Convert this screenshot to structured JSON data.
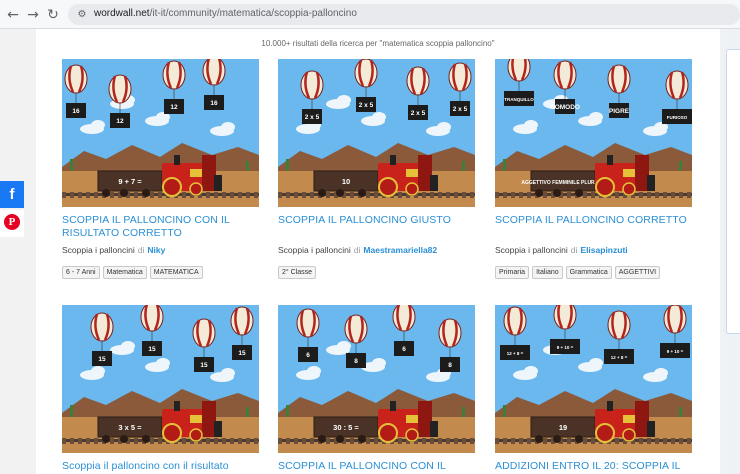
{
  "browser": {
    "back_icon": "←",
    "forward_icon": "→",
    "reload_icon": "↻",
    "site_icon": "⚙",
    "url_host": "wordwall.net",
    "url_path": "/it-it/community/matematica/scoppia-palloncino"
  },
  "search": {
    "result_count": "10.000+ risultati della ricerca per \"matematica scoppia palloncino\""
  },
  "social": {
    "facebook_icon": "f",
    "pinterest_icon": "P"
  },
  "cards": [
    {
      "title": "SCOPPIA IL PALLONCINO CON IL RISULTATO CORRETTO",
      "activity": "Scoppia i palloncini",
      "by": "di",
      "author": "Niky",
      "tags": [
        "6 - 7 Anni",
        "Matematica",
        "MATEMATICA"
      ],
      "balloon_labels": [
        "16",
        "12",
        "12",
        "16"
      ],
      "train_label": "9 + 7 ="
    },
    {
      "title": "SCOPPIA IL PALLONCINO GIUSTO",
      "activity": "Scoppia i palloncini",
      "by": "di",
      "author": "Maestramariella82",
      "tags": [
        "2° Classe"
      ],
      "balloon_labels": [
        "2 x 5",
        "2 x 5",
        "2 x 5",
        "2 x 5"
      ],
      "train_label": "10"
    },
    {
      "title": "SCOPPIA IL PALLONCINO CORRETTO",
      "activity": "Scoppia i palloncini",
      "by": "di",
      "author": "Elisapinzuti",
      "tags": [
        "Primaria",
        "Italiano",
        "Grammatica",
        "AGGETTIVI"
      ],
      "balloon_labels": [
        "TRANQUILLO",
        "COMODO",
        "PIGRE",
        "FURIOSO"
      ],
      "train_label": "AGGETTIVO FEMMINILE PLURALE"
    },
    {
      "title": "Scoppia il palloncino con il  risultato",
      "activity": "",
      "by": "",
      "author": "",
      "tags": [],
      "balloon_labels": [
        "15",
        "15",
        "15",
        "15"
      ],
      "train_label": "3 x 5 ="
    },
    {
      "title": "SCOPPIA IL PALLONCINO CON IL",
      "activity": "",
      "by": "",
      "author": "",
      "tags": [],
      "balloon_labels": [
        "6",
        "8",
        "6",
        "8"
      ],
      "train_label": "30 : 5 ="
    },
    {
      "title": "ADDIZIONI ENTRO IL 20: SCOPPIA IL",
      "activity": "",
      "by": "",
      "author": "",
      "tags": [],
      "balloon_labels": [
        "12 + 8 =",
        "9 + 10 =",
        "12 + 8 =",
        "9 + 10 ="
      ],
      "train_label": "19"
    }
  ],
  "colors": {
    "link_blue": "#2a8fd6",
    "sky": "#6ab8ee",
    "desert": "#c28a4c",
    "train_red": "#c8221b",
    "facebook": "#1877f2",
    "pinterest": "#e60023"
  }
}
